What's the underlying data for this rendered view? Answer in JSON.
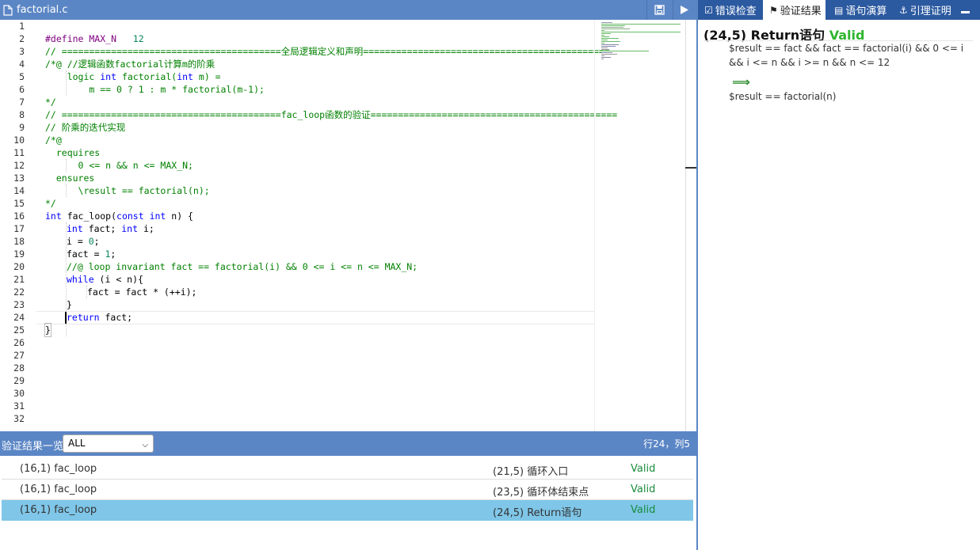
{
  "editor": {
    "file_name": "factorial.c",
    "icons": {
      "file": "file-icon",
      "save": "save-icon",
      "run": "play-icon"
    },
    "line_numbers": [
      "1",
      "2",
      "3",
      "4",
      "5",
      "6",
      "7",
      "8",
      "9",
      "10",
      "11",
      "12",
      "13",
      "14",
      "15",
      "16",
      "17",
      "18",
      "19",
      "20",
      "21",
      "22",
      "23",
      "24",
      "25",
      "26",
      "27",
      "28",
      "29",
      "30",
      "31",
      "32"
    ],
    "code": {
      "l2a": "#define MAX_N   ",
      "l2b": "12",
      "l3": "// ========================================全局逻辑定义和声明=============================================",
      "l4": "/*@ //逻辑函数factorial计算m的阶乘",
      "l5a": "    logic ",
      "l5b": "int",
      "l5c": " factorial(",
      "l5d": "int",
      "l5e": " m) =",
      "l6": "        m == 0 ? 1 : m * factorial(m-1);",
      "l7": "*/",
      "l8": "// ========================================fac_loop函数的验证=============================================",
      "l9": "// 阶乘的迭代实现",
      "l10": "/*@",
      "l11": "  requires",
      "l12": "      0 <= n && n <= MAX_N;",
      "l13": "  ensures",
      "l14": "      \\result == factorial(n);",
      "l15": "*/",
      "l16a": "int",
      "l16b": " fac_loop(",
      "l16c": "const int",
      "l16d": " n) {",
      "l17a": "int",
      "l17b": " fact; ",
      "l17c": "int",
      "l17d": " i;",
      "l18a": "i = ",
      "l18b": "0",
      "l18c": ";",
      "l19a": "fact = ",
      "l19b": "1",
      "l19c": ";",
      "l20": "//@ loop invariant fact == factorial(i) && 0 <= i <= n <= MAX_N;",
      "l21a": "while",
      "l21b": " (i < n){",
      "l22": "fact = fact * (++i);",
      "l23": "}",
      "l24a": "return",
      "l24b": " fact;",
      "l25": "}"
    }
  },
  "results": {
    "title": "验证结果一览",
    "filter_value": "ALL",
    "cursor_pos": "行24，列5",
    "rows": [
      {
        "func": "(16,1) fac_loop",
        "point": "(21,5) 循环入口",
        "status": "Valid"
      },
      {
        "func": "(16,1) fac_loop",
        "point": "(23,5) 循环体结束点",
        "status": "Valid"
      },
      {
        "func": "(16,1) fac_loop",
        "point": "(24,5) Return语句",
        "status": "Valid"
      }
    ]
  },
  "right_panel": {
    "tabs": [
      {
        "label": "错误检查",
        "icon": "check-square-icon"
      },
      {
        "label": "验证结果",
        "icon": "tag-icon"
      },
      {
        "label": "语句演算",
        "icon": "card-icon"
      },
      {
        "label": "引理证明",
        "icon": "anchor-icon"
      }
    ],
    "active_tab": "验证结果",
    "heading": "(24,5) Return语句",
    "heading_status": "Valid",
    "premise": "$result == fact && fact == factorial(i) && 0 <= i && i <= n && i >= n && n <= 12",
    "implies": "⟹",
    "conclusion": "$result == factorial(n)"
  },
  "colors": {
    "header_bg": "#5b86c5",
    "right_tabs_bg": "#2c5aa0",
    "selected_row": "#7fc6e8",
    "valid_green": "#2eb52e"
  }
}
